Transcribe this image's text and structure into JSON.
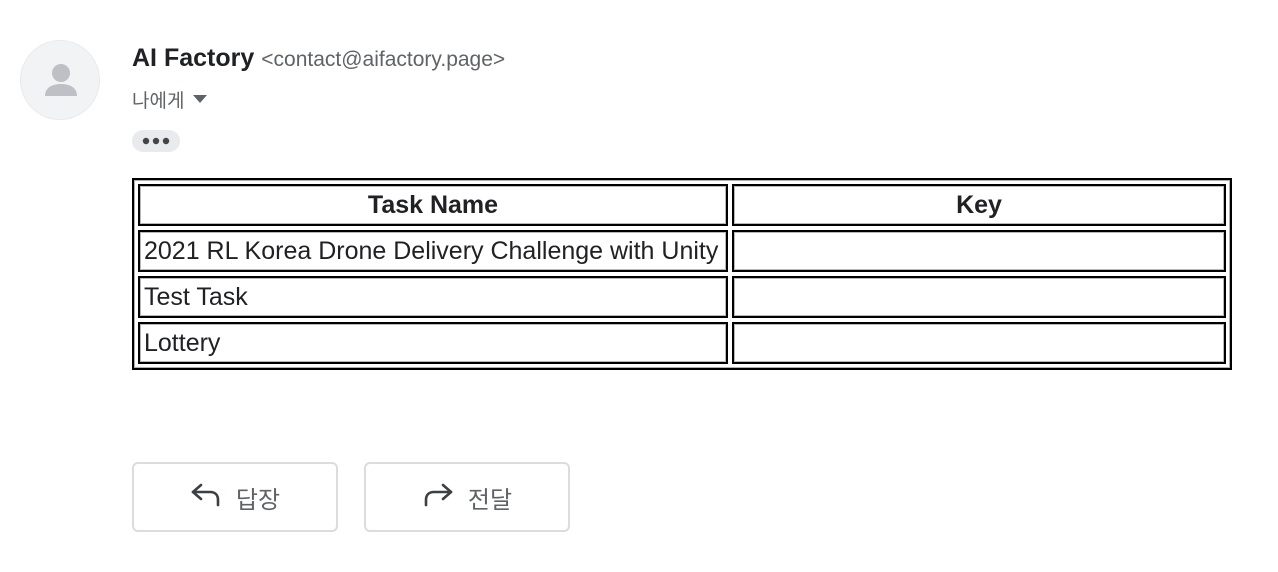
{
  "sender": {
    "name": "AI Factory",
    "email": "<contact@aifactory.page>"
  },
  "recipient": {
    "label": "나에게"
  },
  "table": {
    "headers": [
      "Task Name",
      "Key"
    ],
    "rows": [
      {
        "task": "2021 RL Korea Drone Delivery Challenge with Unity",
        "key": ""
      },
      {
        "task": "Test Task",
        "key": ""
      },
      {
        "task": "Lottery",
        "key": ""
      }
    ]
  },
  "actions": {
    "reply_label": "답장",
    "forward_label": "전달"
  },
  "colors": {
    "avatar_bg": "#f1f3f4",
    "avatar_glyph": "#bdc1c6",
    "muted_text": "#5f6368",
    "button_border": "#dadce0"
  }
}
